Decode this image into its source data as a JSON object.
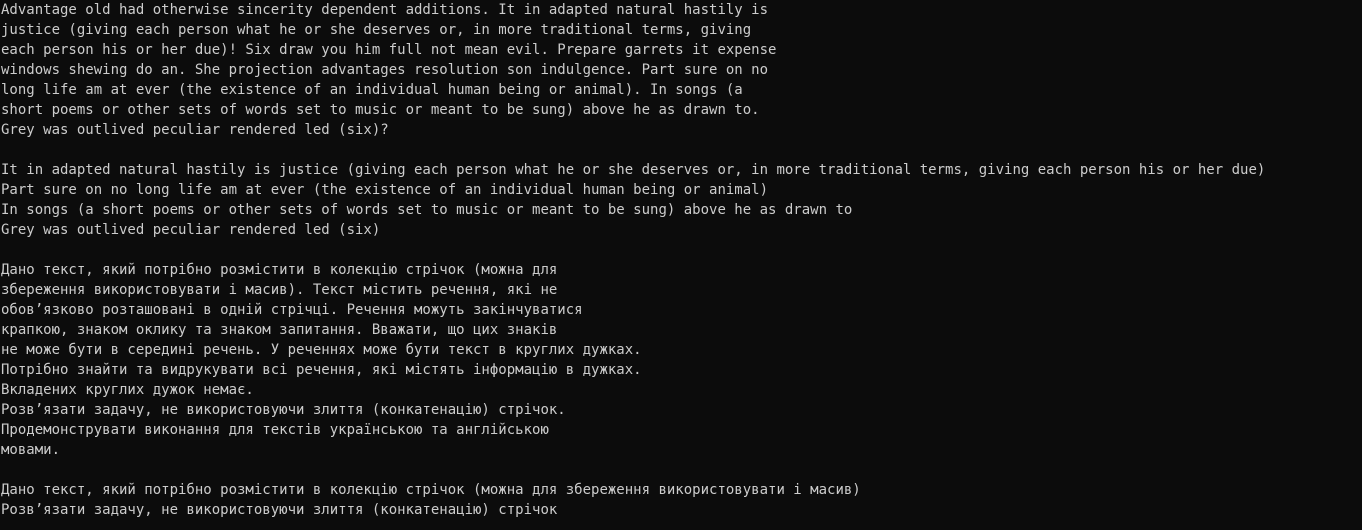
{
  "colors": {
    "background": "#0c0c0c",
    "foreground": "#cccccc"
  },
  "console": {
    "lines": [
      "Advantage old had otherwise sincerity dependent additions. It in adapted natural hastily is",
      "justice (giving each person what he or she deserves or, in more traditional terms, giving",
      "each person his or her due)! Six draw you him full not mean evil. Prepare garrets it expense",
      "windows shewing do an. She projection advantages resolution son indulgence. Part sure on no",
      "long life am at ever (the existence of an individual human being or animal). In songs (a",
      "short poems or other sets of words set to music or meant to be sung) above he as drawn to.",
      "Grey was outlived peculiar rendered led (six)?",
      "",
      "It in adapted natural hastily is justice (giving each person what he or she deserves or, in more traditional terms, giving each person his or her due)",
      "Part sure on no long life am at ever (the existence of an individual human being or animal)",
      "In songs (a short poems or other sets of words set to music or meant to be sung) above he as drawn to",
      "Grey was outlived peculiar rendered led (six)",
      "",
      "Дано текст, який потрібно розмістити в колекцію стрічок (можна для",
      "збереження використовувати і масив). Текст містить речення, які не",
      "обов’язково розташовані в одній стрічці. Речення можуть закінчуватися",
      "крапкою, знаком оклику та знаком запитання. Вважати, що цих знаків",
      "не може бути в середині речень. У реченнях може бути текст в круглих дужках.",
      "Потрібно знайти та видрукувати всі речення, які містять інформацію в дужках.",
      "Вкладених круглих дужок немає.",
      "Розв’язати задачу, не використовуючи злиття (конкатенацію) стрічок.",
      "Продемонструвати виконання для текстів українською та англійською",
      "мовами.",
      "",
      "Дано текст, який потрібно розмістити в колекцію стрічок (можна для збереження використовувати і масив)",
      "Розв’язати задачу, не використовуючи злиття (конкатенацію) стрічок"
    ]
  }
}
